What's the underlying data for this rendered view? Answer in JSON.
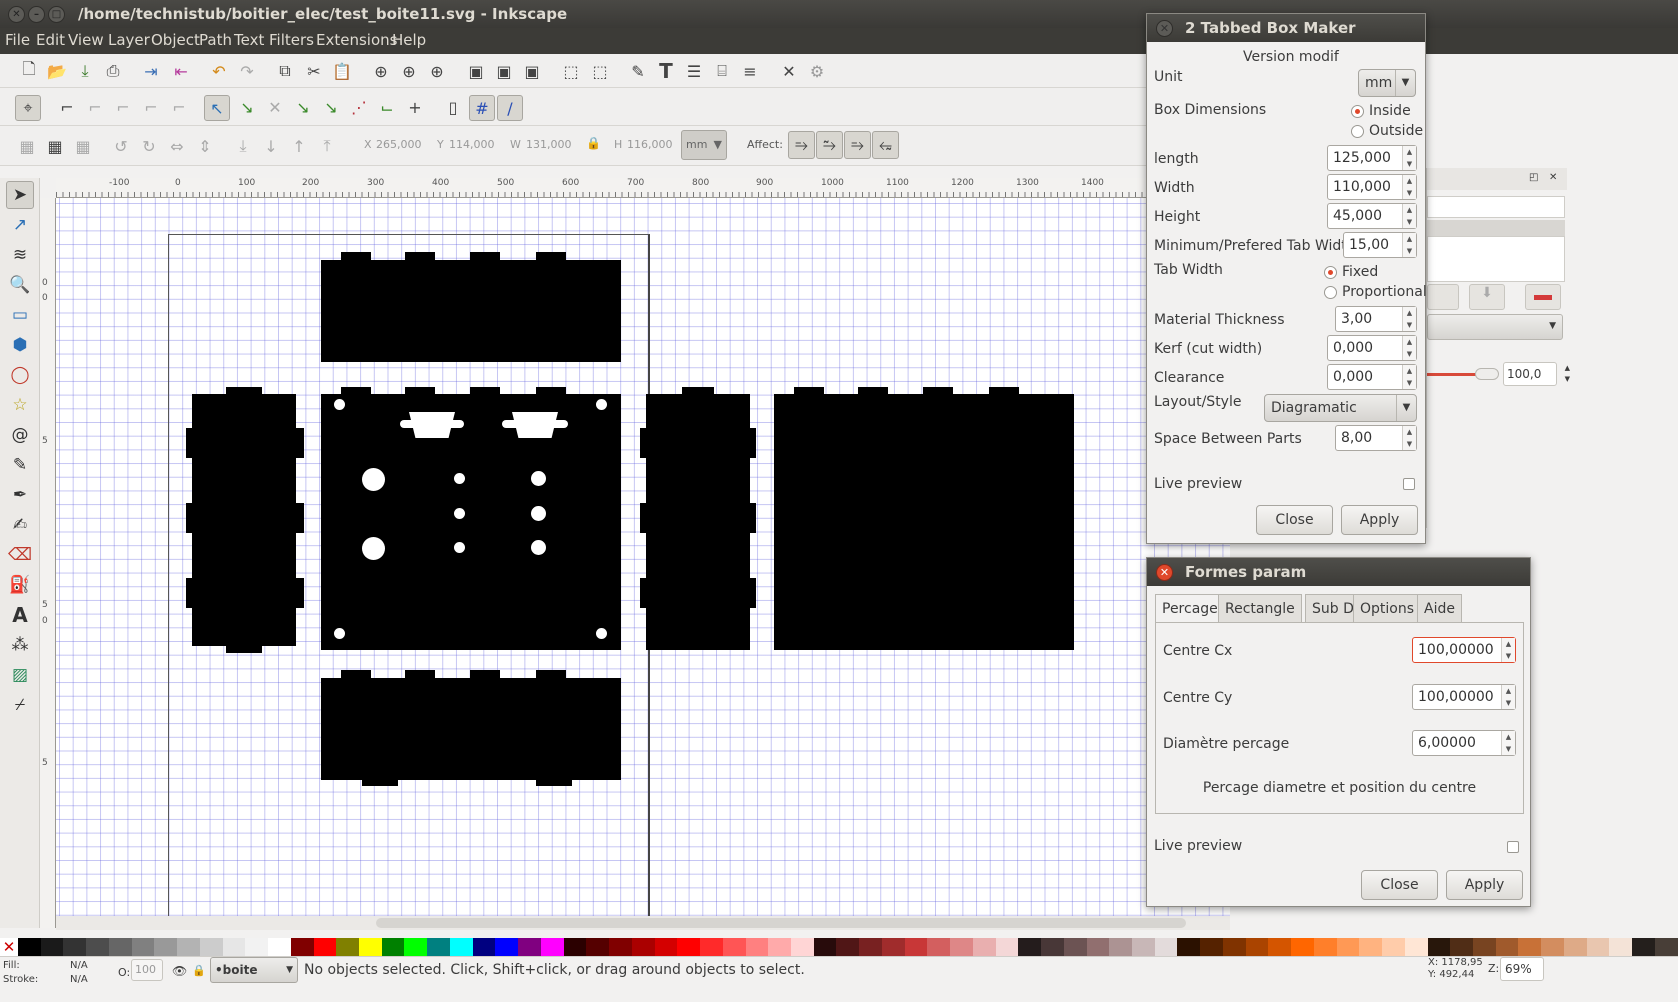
{
  "window": {
    "title": "/home/technistub/boitier_elec/test_boite11.svg - Inkscape"
  },
  "menu": [
    "File",
    "Edit",
    "View",
    "Layer",
    "Object",
    "Path",
    "Text",
    "Filters",
    "Extensions",
    "Help"
  ],
  "toolbar": {
    "x_label": "X",
    "x_value": "265,000",
    "y_label": "Y",
    "y_value": "114,000",
    "w_label": "W",
    "w_value": "131,000",
    "h_label": "H",
    "h_value": "116,000",
    "unit": "mm",
    "affect_label": "Affect:"
  },
  "ruler": {
    "h_ticks": [
      "-100",
      "0",
      "100",
      "200",
      "300",
      "400",
      "500",
      "600",
      "700",
      "800",
      "900",
      "1000",
      "1100",
      "1200",
      "1300",
      "1400"
    ],
    "v_ticks": [
      "0",
      "0",
      "5",
      "5",
      "0",
      "5"
    ]
  },
  "tabbed_box": {
    "title": "2 Tabbed Box Maker",
    "version": "Version modif",
    "unit_label": "Unit",
    "unit_value": "mm",
    "box_dim_label": "Box Dimensions",
    "inside": "Inside",
    "outside": "Outside",
    "length_label": "length",
    "length": "125,000",
    "width_label": "Width",
    "width": "110,000",
    "height_label": "Height",
    "height": "45,000",
    "min_tab_label": "Minimum/Prefered Tab Width",
    "min_tab": "15,00",
    "tab_width_label": "Tab Width",
    "fixed": "Fixed",
    "proportional": "Proportional",
    "thickness_label": "Material Thickness",
    "thickness": "3,00",
    "kerf_label": "Kerf (cut width)",
    "kerf": "0,000",
    "clearance_label": "Clearance",
    "clearance": "0,000",
    "layout_label": "Layout/Style",
    "layout": "Diagramatic",
    "space_label": "Space Between Parts",
    "space": "8,00",
    "live_preview": "Live preview",
    "close": "Close",
    "apply": "Apply"
  },
  "formes": {
    "title": "Formes param",
    "tabs": [
      "Percage",
      "Rectangle",
      "Sub D",
      "Options",
      "Aide"
    ],
    "cx_label": "Centre Cx",
    "cx": "100,00000",
    "cy_label": "Centre Cy",
    "cy": "100,00000",
    "diam_label": "Diamètre percage",
    "diam": "6,00000",
    "description": "Percage diametre et position du centre",
    "live_preview": "Live preview",
    "close": "Close",
    "apply": "Apply"
  },
  "side_panel": {
    "value": "100,0"
  },
  "status": {
    "fill_label": "Fill:",
    "fill": "N/A",
    "stroke_label": "Stroke:",
    "stroke": "N/A",
    "opacity_label": "O:",
    "opacity": "100",
    "layer": "•boite",
    "message": "No objects selected. Click, Shift+click, or drag around objects to select.",
    "x": "X: 1178,95",
    "y": "Y:   492,44",
    "zoom_label": "Z:",
    "zoom": "69%"
  },
  "colors": {
    "accent": "#e0482b",
    "grid": "#5a5adc"
  }
}
